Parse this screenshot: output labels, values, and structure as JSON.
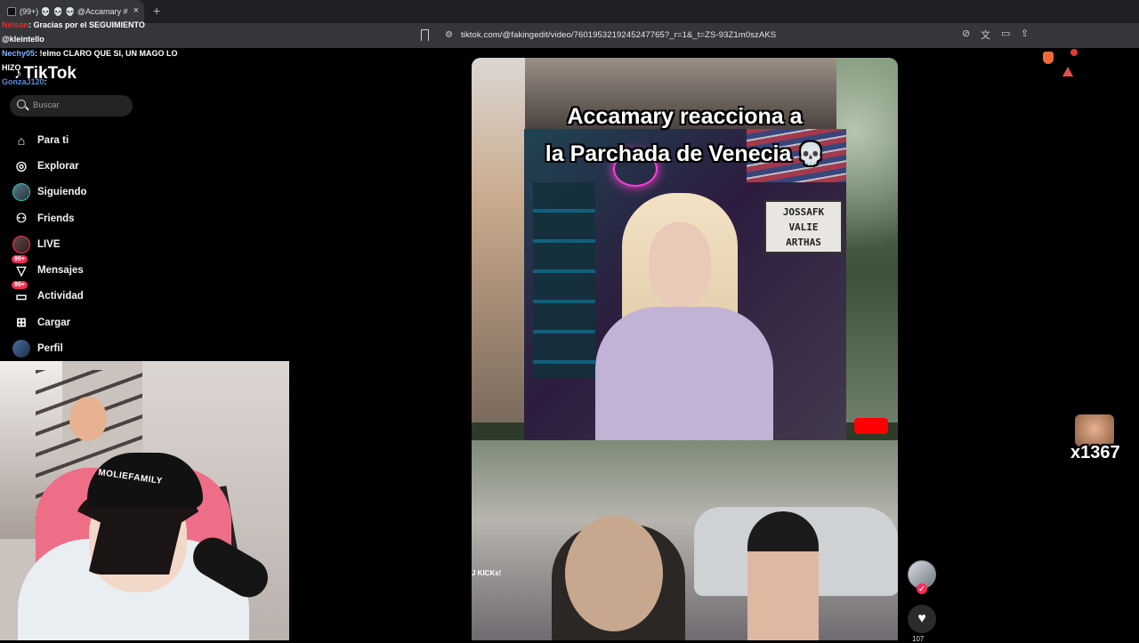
{
  "browser": {
    "tab_title": "(99+) 💀 💀 💀 @Accamary #",
    "tab_close": "×",
    "new_tab": "+",
    "url": "tiktok.com/@fakingedit/video/7601953219245247765?_r=1&_t=ZS-93Z1m0szAKS"
  },
  "chat": [
    {
      "user": "Nelson",
      "text": ": Gracias por el SEGUIMIENTO"
    },
    {
      "user": "@kleintello",
      "text": ""
    },
    {
      "user": "Nechy05",
      "text": ": !elmo CLARO QUE SI, UN MAGO LO"
    },
    {
      "user": "HIZO",
      "text": ""
    },
    {
      "user": "GonzaJ120",
      "text": ":"
    }
  ],
  "tiktok": {
    "logo": "TikTok",
    "search_placeholder": "Buscar",
    "nav": [
      {
        "label": "Para ti",
        "icon": "home-icon"
      },
      {
        "label": "Explorar",
        "icon": "compass-icon"
      },
      {
        "label": "Siguiendo",
        "icon": "avatar"
      },
      {
        "label": "Friends",
        "icon": "friends-icon"
      },
      {
        "label": "LIVE",
        "icon": "live-avatar"
      },
      {
        "label": "Mensajes",
        "icon": "messages-icon",
        "badge": "99+"
      },
      {
        "label": "Actividad",
        "icon": "activity-icon",
        "badge": "99+"
      },
      {
        "label": "Cargar",
        "icon": "upload-icon"
      },
      {
        "label": "Perfil",
        "icon": "profile-avatar"
      }
    ]
  },
  "video": {
    "caption_line1": "Accamary reacciona a",
    "caption_line2": "la Parchada de Venecia",
    "caption_emoji": "💀",
    "sign_lines": [
      "JOSSAFK",
      "VALIE",
      "ARTHAS"
    ],
    "kicks_text": "J KICKs!"
  },
  "webcam": {
    "cap_text": "MOLIEFAMILY"
  },
  "actions": {
    "like_count": "107"
  },
  "emote": {
    "count": "x1367"
  },
  "colors": {
    "tiktok_red": "#fe2c55",
    "chrome_bg": "#35363a"
  }
}
